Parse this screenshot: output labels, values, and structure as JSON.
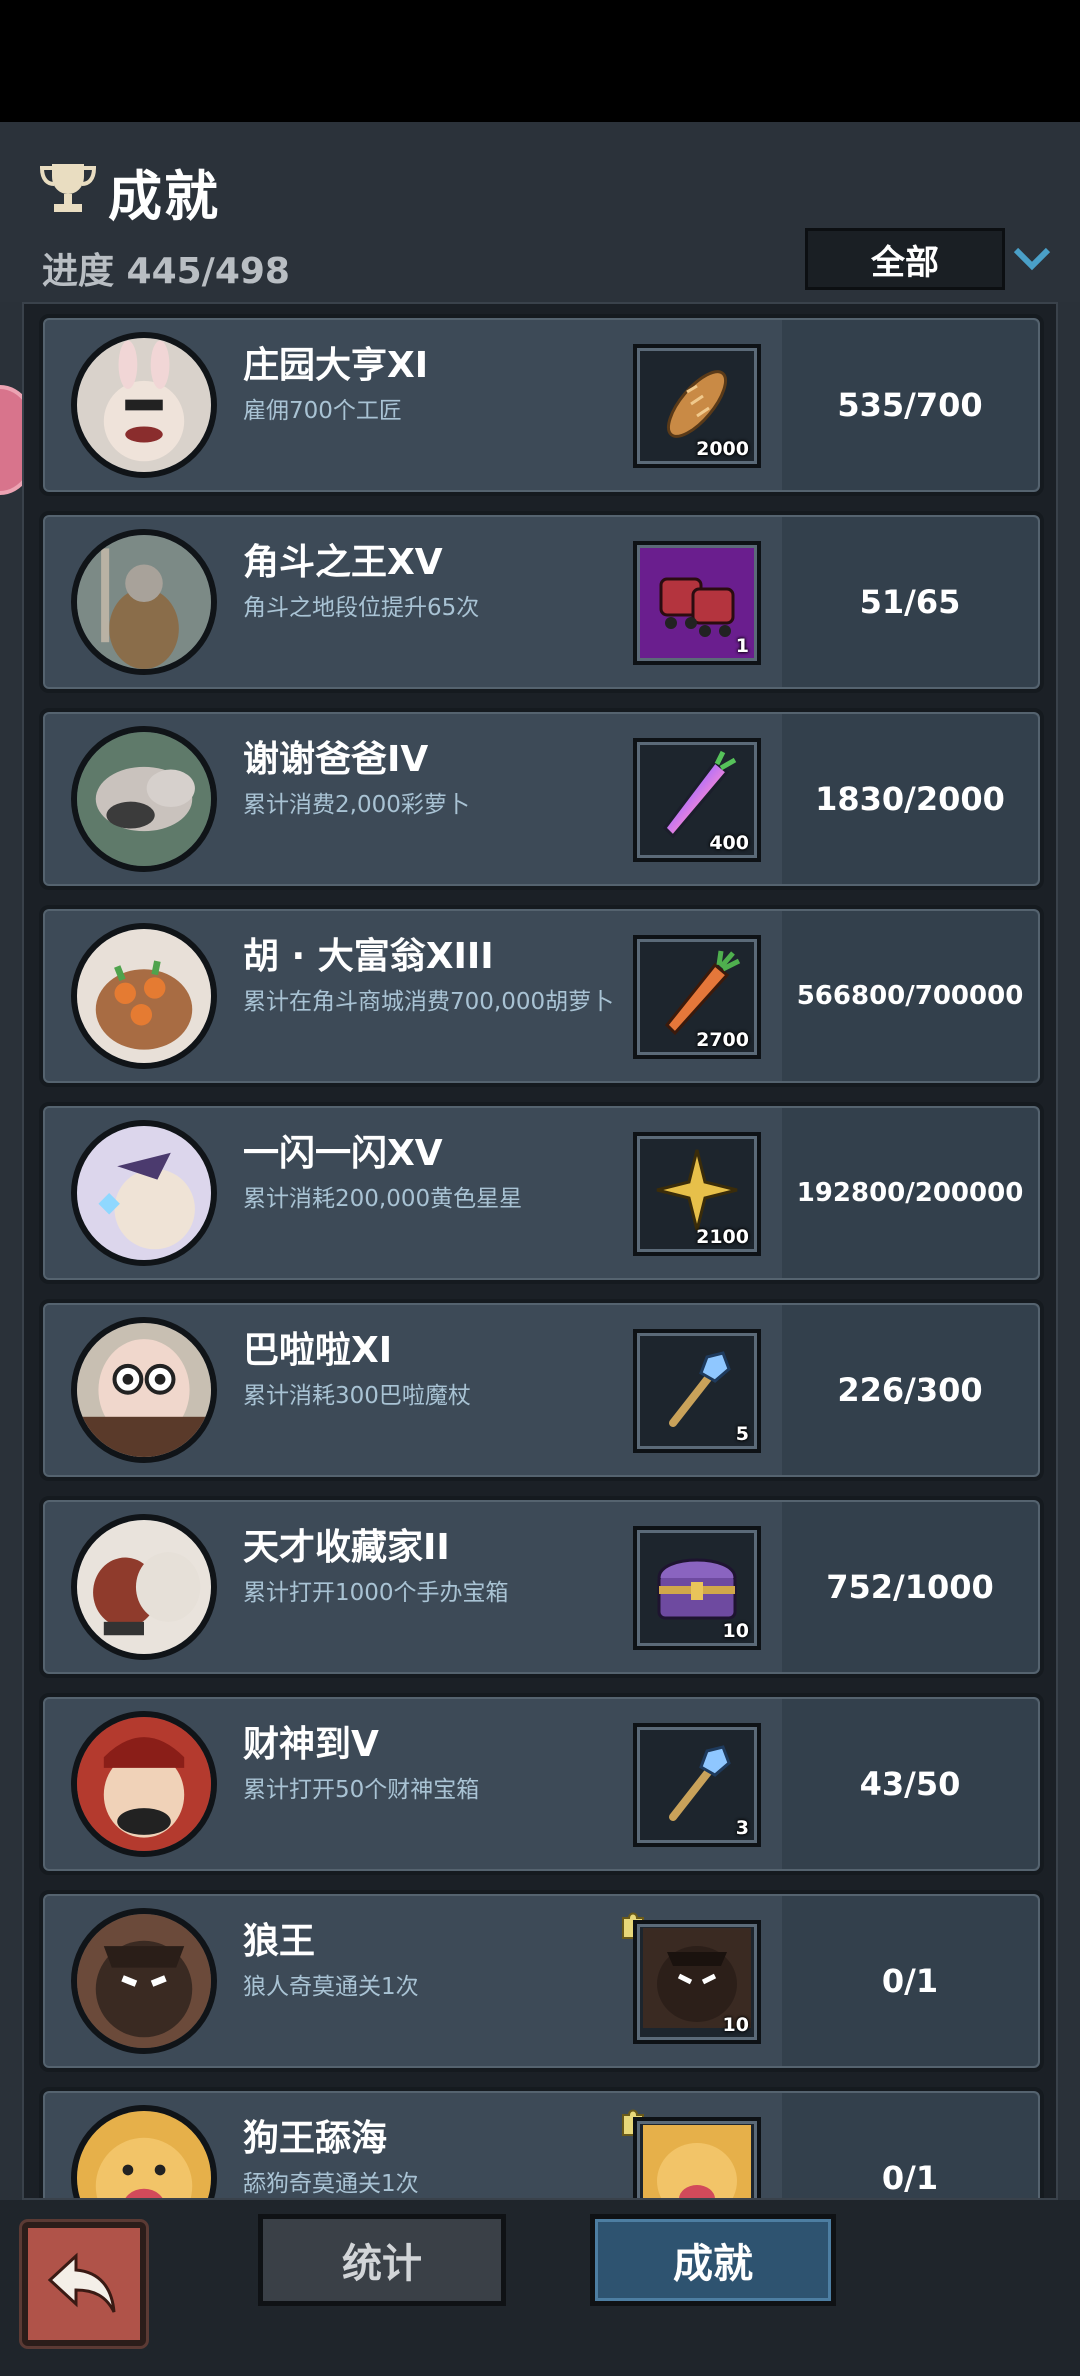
{
  "header": {
    "title": "成就",
    "progress_text": "进度 445/498",
    "filter_label": "全部"
  },
  "achievements": [
    {
      "title": "庄园大亨XI",
      "desc": "雇佣700个工匠",
      "reward_icon": "bread-icon",
      "reward_qty": "2000",
      "progress": "535/700"
    },
    {
      "title": "角斗之王XV",
      "desc": "角斗之地段位提升65次",
      "reward_icon": "skates-icon",
      "reward_qty": "1",
      "progress": "51/65"
    },
    {
      "title": "谢谢爸爸IV",
      "desc": "累计消费2,000彩萝卜",
      "reward_icon": "rainbow-carrot-icon",
      "reward_qty": "400",
      "progress": "1830/2000"
    },
    {
      "title": "胡 · 大富翁XIII",
      "desc": "累计在角斗商城消费700,000胡萝卜",
      "reward_icon": "carrot-icon",
      "reward_qty": "2700",
      "progress": "566800/700000"
    },
    {
      "title": "一闪一闪XV",
      "desc": "累计消耗200,000黄色星星",
      "reward_icon": "star-icon",
      "reward_qty": "2100",
      "progress": "192800/200000"
    },
    {
      "title": "巴啦啦XI",
      "desc": "累计消耗300巴啦魔杖",
      "reward_icon": "wand-icon",
      "reward_qty": "5",
      "progress": "226/300"
    },
    {
      "title": "天才收藏家II",
      "desc": "累计打开1000个手办宝箱",
      "reward_icon": "chest-icon",
      "reward_qty": "10",
      "progress": "752/1000"
    },
    {
      "title": "财神到V",
      "desc": "累计打开50个财神宝箱",
      "reward_icon": "wand-icon",
      "reward_qty": "3",
      "progress": "43/50"
    },
    {
      "title": "狼王",
      "desc": "狼人奇莫通关1次",
      "reward_icon": "wolf-portrait-icon",
      "reward_qty": "10",
      "progress": "0/1"
    },
    {
      "title": "狗王舔海",
      "desc": "舔狗奇莫通关1次",
      "reward_icon": "dog-portrait-icon",
      "reward_qty": "",
      "progress": "0/1"
    }
  ],
  "tabs": {
    "stats_label": "统计",
    "achievements_label": "成就"
  },
  "colors": {
    "accent_blue": "#2e5370",
    "desc_text": "#a9c3d4",
    "card_bg": "#3d4a57"
  }
}
